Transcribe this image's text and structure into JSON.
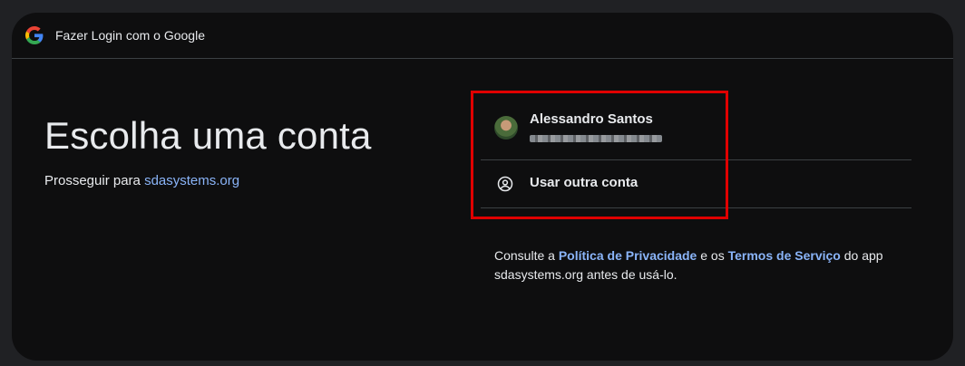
{
  "header": {
    "title": "Fazer Login com o Google",
    "logo_icon": "google-g-icon"
  },
  "main": {
    "title": "Escolha uma conta",
    "continue_prefix": "Prosseguir para",
    "continue_link": "sdasystems.org"
  },
  "accounts": [
    {
      "name": "Alessandro Santos",
      "email_redacted": true,
      "avatar_icon": "avatar"
    }
  ],
  "other_account": {
    "label": "Usar outra conta",
    "icon": "account-circle-icon"
  },
  "footer": {
    "text_1": "Consulte a",
    "privacy_link": "Política de Privacidade",
    "text_2": "e os",
    "terms_link": "Termos de Serviço",
    "text_3": "do app sdasystems.org antes de usá-lo."
  },
  "colors": {
    "background": "#202124",
    "card": "#0e0e0f",
    "text": "#e8eaed",
    "link": "#8ab4f8",
    "divider": "#3c4043",
    "highlight": "#e00000"
  }
}
